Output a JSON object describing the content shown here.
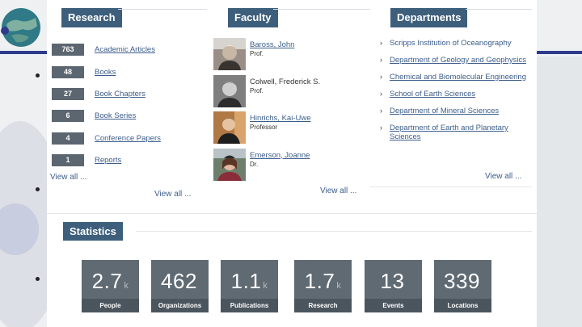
{
  "research": {
    "header": "Research",
    "items": [
      {
        "count": "763",
        "label": "Academic Articles"
      },
      {
        "count": "48",
        "label": "Books"
      },
      {
        "count": "27",
        "label": "Book Chapters"
      },
      {
        "count": "6",
        "label": "Book Series"
      },
      {
        "count": "4",
        "label": "Conference Papers"
      },
      {
        "count": "1",
        "label": "Reports"
      }
    ],
    "view_all_inner": "View all ...",
    "view_all_outer": "View all ..."
  },
  "faculty": {
    "header": "Faculty",
    "people": [
      {
        "name": "Baross, John",
        "title": "Prof."
      },
      {
        "name": "Colwell, Frederick S.",
        "title": "Prof."
      },
      {
        "name": "Hinrichs, Kai-Uwe",
        "title": "Professor"
      },
      {
        "name": "Emerson, Joanne",
        "title": "Dr."
      }
    ],
    "view_all": "View all ..."
  },
  "departments": {
    "header": "Departments",
    "items": [
      "Scripps Institution of Oceanography",
      "Department of Geology and Geophysics",
      "Chemical and Biomolecular Engineering",
      "School of Earth Sciences",
      "Department of Mineral Sciences",
      "Department of Earth and Planetary Sciences"
    ],
    "view_all": "View all ..."
  },
  "statistics": {
    "header": "Statistics",
    "tiles": [
      {
        "value": "2.7",
        "suffix": "k",
        "label": "People"
      },
      {
        "value": "462",
        "suffix": "",
        "label": "Organizations"
      },
      {
        "value": "1.1",
        "suffix": "k",
        "label": "Publications"
      },
      {
        "value": "1.7",
        "suffix": "k",
        "label": "Research"
      },
      {
        "value": "13",
        "suffix": "",
        "label": "Events"
      },
      {
        "value": "339",
        "suffix": "",
        "label": "Locations"
      }
    ]
  },
  "colors": {
    "header_bg": "#3d5f7c",
    "tile_bg": "#5f6a73",
    "link": "#3c5d8a",
    "slide_band": "#2e3a8c"
  }
}
